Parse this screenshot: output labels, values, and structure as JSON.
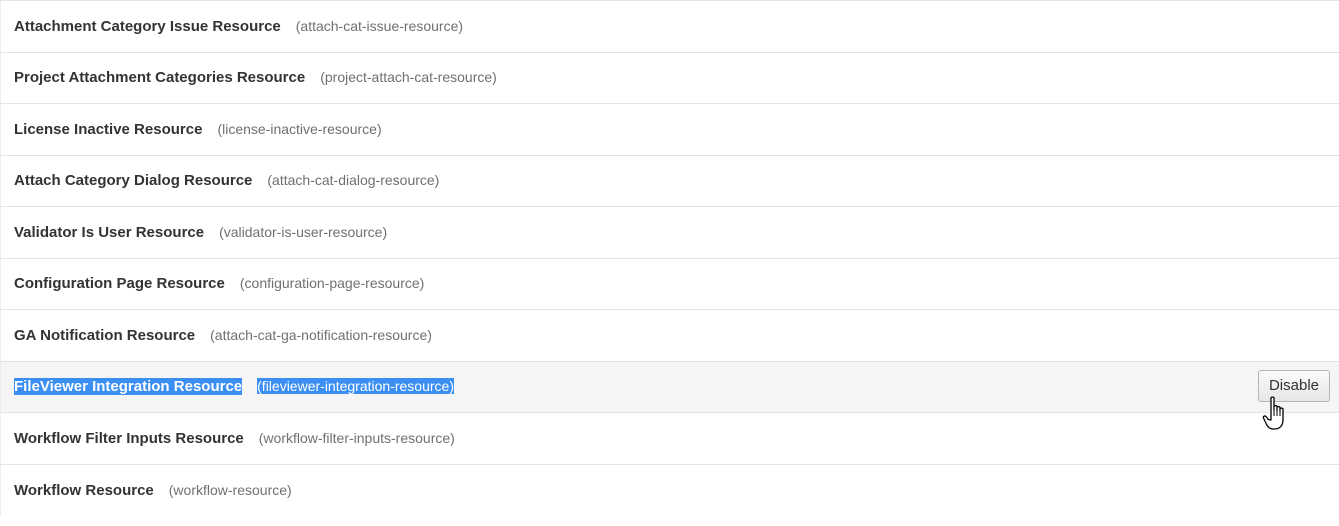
{
  "resources": [
    {
      "name": "Attachment Category Issue Resource",
      "key": "(attach-cat-issue-resource)"
    },
    {
      "name": "Project Attachment Categories Resource",
      "key": "(project-attach-cat-resource)"
    },
    {
      "name": "License Inactive Resource",
      "key": "(license-inactive-resource)"
    },
    {
      "name": "Attach Category Dialog Resource",
      "key": "(attach-cat-dialog-resource)"
    },
    {
      "name": "Validator Is User Resource",
      "key": "(validator-is-user-resource)"
    },
    {
      "name": "Configuration Page Resource",
      "key": "(configuration-page-resource)"
    },
    {
      "name": "GA Notification Resource",
      "key": "(attach-cat-ga-notification-resource)"
    },
    {
      "name": "FileViewer Integration Resource",
      "key": "(fileviewer-integration-resource)",
      "selected": true,
      "action": "Disable"
    },
    {
      "name": "Workflow Filter Inputs Resource",
      "key": "(workflow-filter-inputs-resource)"
    },
    {
      "name": "Workflow Resource",
      "key": "(workflow-resource)"
    }
  ],
  "colors": {
    "selection": "#3b8ff2",
    "name_text": "#333333",
    "key_text": "#707070",
    "divider": "#e3e3e3"
  },
  "icons": {
    "cursor": "hand-pointer-icon"
  }
}
